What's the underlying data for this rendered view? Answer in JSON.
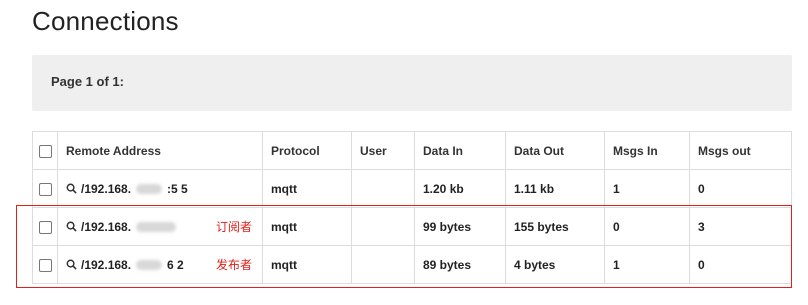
{
  "page_title": "Connections",
  "pager": {
    "label": "Page 1 of 1:"
  },
  "table": {
    "headers": [
      "Remote Address",
      "Protocol",
      "User",
      "Data In",
      "Data Out",
      "Msgs In",
      "Msgs out"
    ],
    "rows": [
      {
        "address_prefix": "/192.168.",
        "address_suffix": ":5   5",
        "tag": "",
        "protocol": "mqtt",
        "user": "",
        "data_in": "1.20 kb",
        "data_out": "1.11 kb",
        "msgs_in": "1",
        "msgs_out": "0"
      },
      {
        "address_prefix": "/192.168.",
        "address_suffix": "",
        "tag": "订阅者",
        "protocol": "mqtt",
        "user": "",
        "data_in": "99 bytes",
        "data_out": "155 bytes",
        "msgs_in": "0",
        "msgs_out": "3"
      },
      {
        "address_prefix": "/192.168.",
        "address_suffix": "6   2",
        "tag": "发布者",
        "protocol": "mqtt",
        "user": "",
        "data_in": "89 bytes",
        "data_out": "4 bytes",
        "msgs_in": "1",
        "msgs_out": "0"
      }
    ]
  },
  "colors": {
    "annotation": "#e0201a",
    "pager_bg": "#efefef",
    "border": "#dcdcdc"
  },
  "icons": {
    "row_action": "zoom-icon"
  }
}
